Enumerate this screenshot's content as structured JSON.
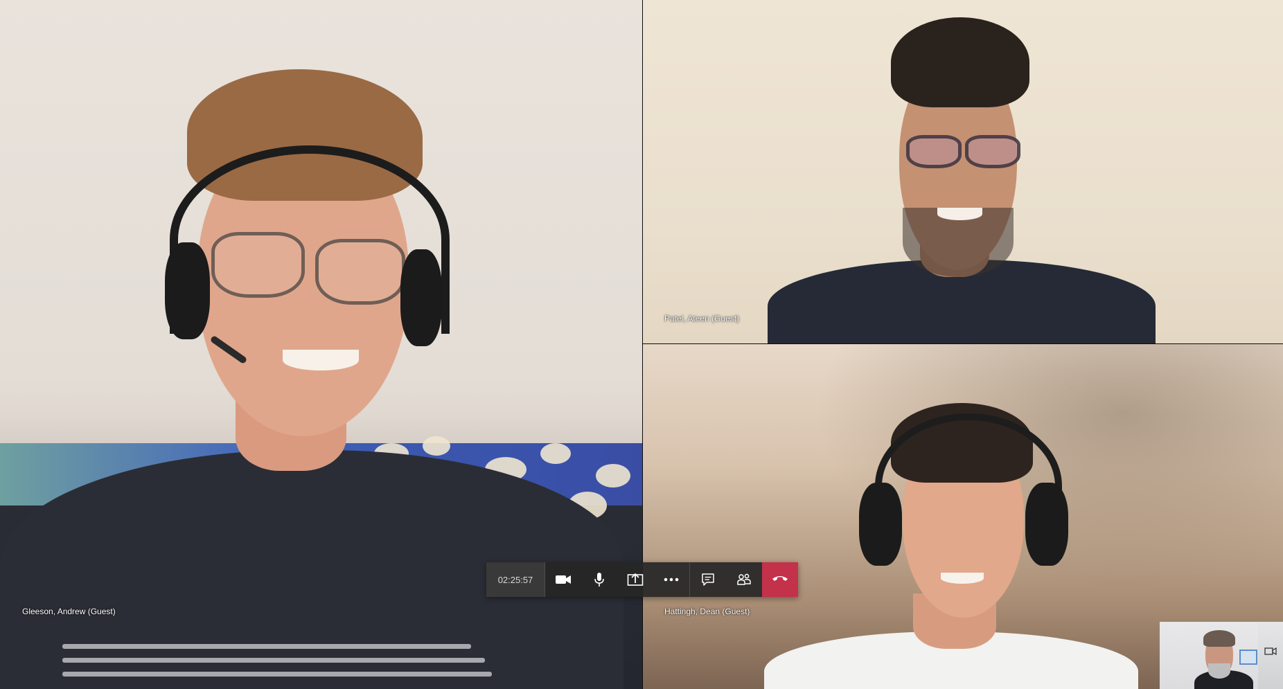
{
  "participants": [
    {
      "name": "Gleeson, Andrew (Guest)"
    },
    {
      "name": "Patel, Ateen (Guest)"
    },
    {
      "name": "Hattingh, Dean (Guest)"
    }
  ],
  "controls": {
    "timer": "02:25:57",
    "icons": [
      "camera-icon",
      "microphone-icon",
      "share-screen-icon",
      "more-options-icon",
      "chat-icon",
      "participants-icon",
      "hang-up-icon"
    ]
  },
  "colors": {
    "hangup": "#c4314b",
    "control_bar": "#262626"
  }
}
